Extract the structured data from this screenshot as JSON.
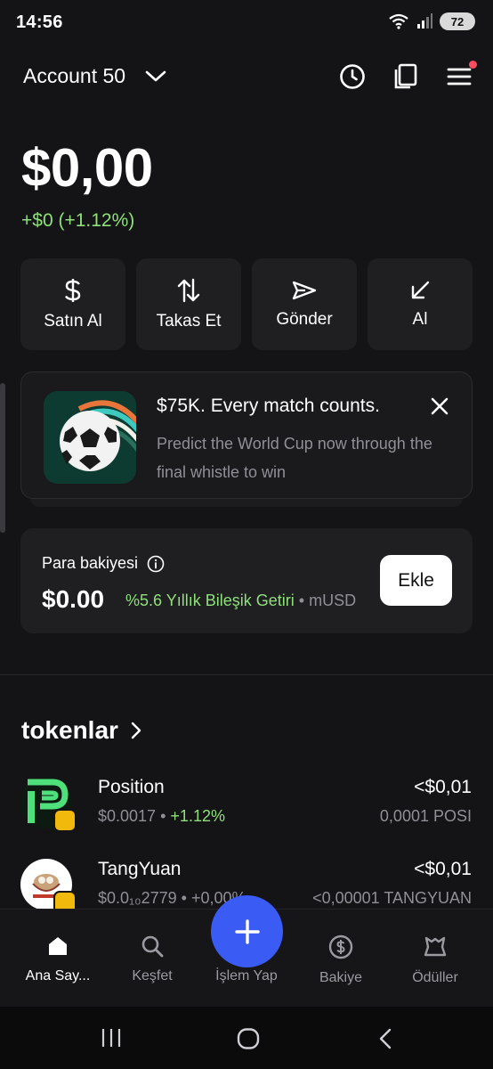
{
  "status_bar": {
    "time": "14:56",
    "battery": "72"
  },
  "header": {
    "account_name": "Account 50"
  },
  "balance": {
    "amount": "$0,00",
    "change": "+$0 (+1.12%)"
  },
  "actions": [
    {
      "label": "Satın Al",
      "icon": "dollar-icon"
    },
    {
      "label": "Takas Et",
      "icon": "swap-icon"
    },
    {
      "label": "Gönder",
      "icon": "send-icon"
    },
    {
      "label": "Al",
      "icon": "receive-icon"
    }
  ],
  "promo": {
    "title": "$75K. Every match counts.",
    "description": "Predict the World Cup now through the final whistle to win"
  },
  "cash": {
    "title": "Para bakiyesi",
    "amount": "$0.00",
    "yield": "%5.6 Yıllık Bileşik Getiri",
    "separator": "•",
    "asset": "mUSD",
    "add_label": "Ekle"
  },
  "tokens": {
    "title": "tokenlar",
    "items": [
      {
        "name": "Position",
        "price": "$0.0017",
        "separator": "•",
        "change": "+1.12%",
        "value": "<$0,01",
        "quantity": "0,0001 POSI"
      },
      {
        "name": "TangYuan",
        "price": "$0.0₁₀2779",
        "separator": "•",
        "change": "+0,00%",
        "value": "<$0,01",
        "quantity": "<0,00001 TANGYUAN"
      }
    ]
  },
  "bottom_nav": [
    {
      "label": "Ana Say...",
      "icon": "home-icon",
      "active": true
    },
    {
      "label": "Keşfet",
      "icon": "search-icon"
    },
    {
      "label": "İşlem Yap",
      "icon": "plus-icon"
    },
    {
      "label": "Bakiye",
      "icon": "dollar-circle-icon"
    },
    {
      "label": "Ödüller",
      "icon": "rewards-icon"
    }
  ],
  "colors": {
    "background": "#141416",
    "accent": "#3b5bf5",
    "positive": "#8fe07a",
    "card": "#1f1f22"
  }
}
